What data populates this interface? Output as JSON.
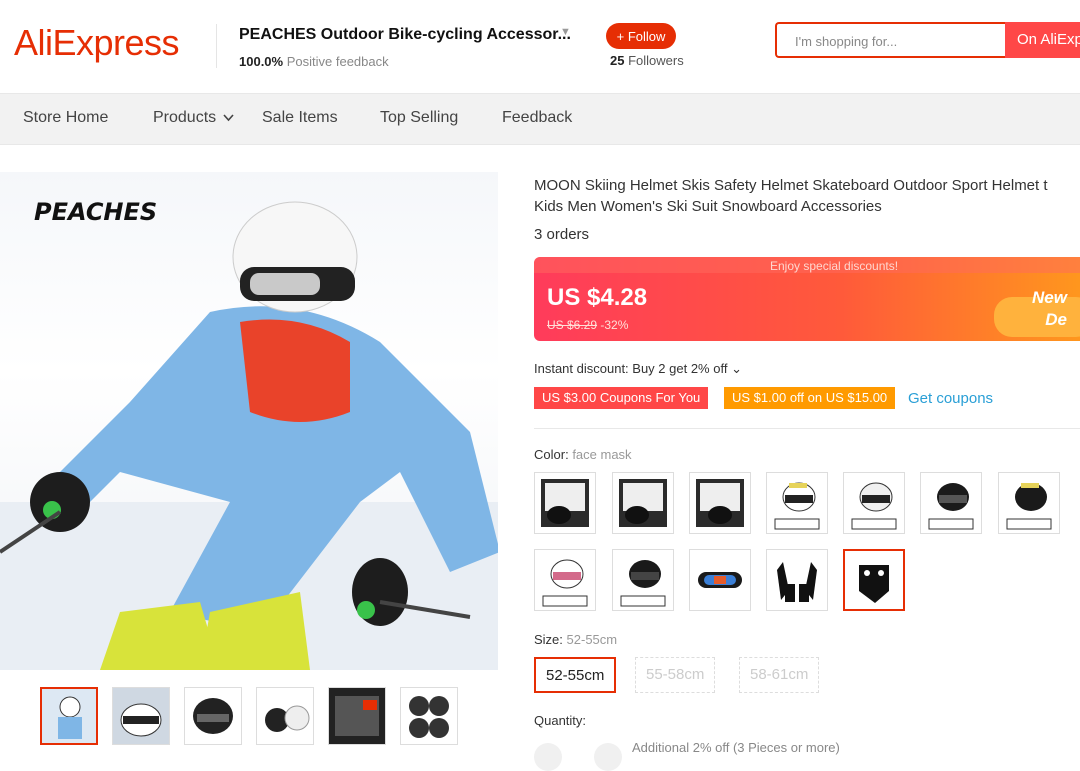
{
  "header": {
    "logo": "AliExpress",
    "store_name": "PEACHES Outdoor Bike-cycling Accessor...",
    "feedback_pct": "100.0%",
    "feedback_label": "Positive feedback",
    "follow_label": "+ Follow",
    "followers_count": "25",
    "followers_label": "Followers",
    "search_placeholder": "I'm shopping for...",
    "search_button": "On AliExp"
  },
  "nav": {
    "items": [
      "Store Home",
      "Products",
      "Sale Items",
      "Top Selling",
      "Feedback"
    ]
  },
  "gallery": {
    "brand_text": "PEACHES",
    "thumbnails": [
      "thumb-1",
      "thumb-2",
      "thumb-3",
      "thumb-4",
      "thumb-5",
      "thumb-6"
    ],
    "selected_index": 0
  },
  "product": {
    "title": "MOON Skiing Helmet Skis Safety Helmet Skateboard Outdoor Sport Helmet t Kids Men Women's Ski Suit Snowboard Accessories",
    "orders": "3 orders",
    "enjoy": "Enjoy special discounts!",
    "price": "US $4.28",
    "old_price": "US $6.29",
    "discount": "-32%",
    "banner_line1": "New",
    "banner_line2": "De",
    "instant_discount": "Instant discount: Buy 2 get 2% off",
    "coupons": [
      "US $3.00 Coupons For You",
      "US $1.00 off on US $15.00"
    ],
    "get_coupons": "Get coupons",
    "color_label": "Color:",
    "color_value": "face mask",
    "size_label": "Size:",
    "size_value": "52-55cm",
    "sizes": [
      "52-55cm",
      "55-58cm",
      "58-61cm"
    ],
    "quantity_label": "Quantity:",
    "quantity_note": "Additional 2% off (3 Pieces or more)"
  },
  "colors": {
    "accent": "#e62e04",
    "link": "#2a9fd6"
  }
}
